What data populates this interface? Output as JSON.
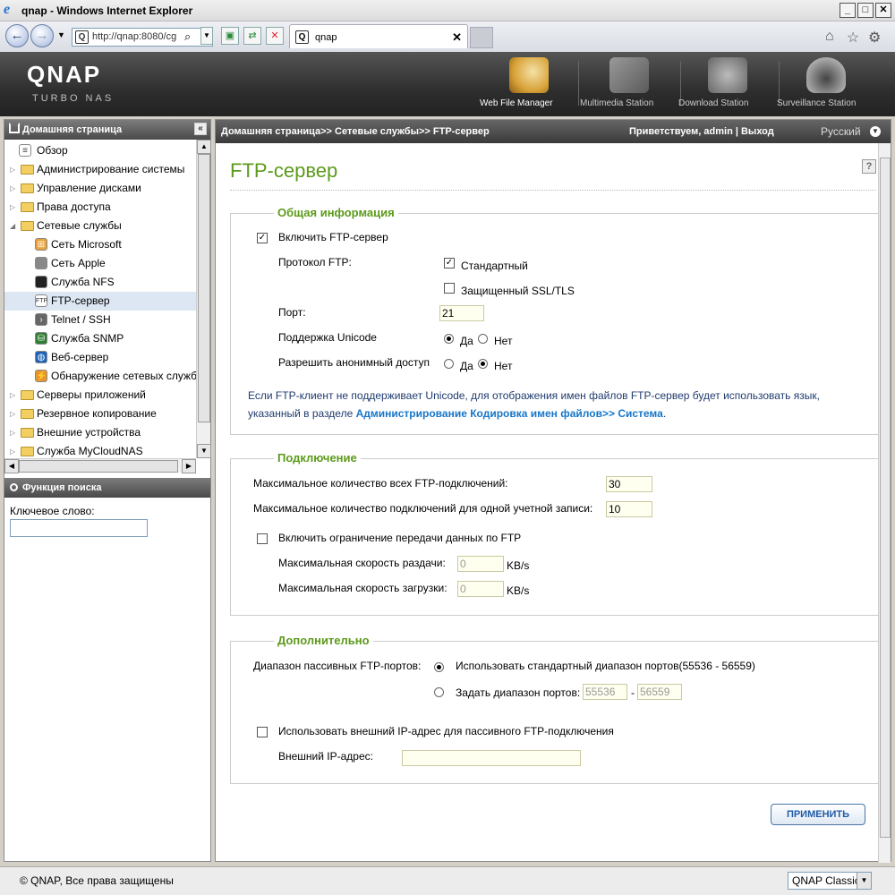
{
  "window": {
    "title": "qnap - Windows Internet Explorer",
    "address": "http://qnap:8080/cg",
    "tab_label": "qnap",
    "favicon_letter": "Q"
  },
  "header": {
    "logo": "QNAP",
    "subtitle": "TURBO NAS",
    "apps": [
      {
        "label": "Web File Manager",
        "color": "#d8a238"
      },
      {
        "label": "Multimedia Station",
        "color": "#7b7b7b"
      },
      {
        "label": "Download Station",
        "color": "#8a8a8a"
      },
      {
        "label": "Surveillance Station",
        "color": "#9a9a9a"
      }
    ]
  },
  "sidebar": {
    "title": "Домашняя страница",
    "items": [
      {
        "label": "Обзор"
      },
      {
        "label": "Администрирование системы"
      },
      {
        "label": "Управление дисками"
      },
      {
        "label": "Права доступа"
      },
      {
        "label": "Сетевые службы"
      },
      {
        "label": "Сеть Microsoft"
      },
      {
        "label": "Сеть Apple"
      },
      {
        "label": "Служба NFS"
      },
      {
        "label": "FTP-сервер"
      },
      {
        "label": "Telnet / SSH"
      },
      {
        "label": "Служба SNMP"
      },
      {
        "label": "Веб-сервер"
      },
      {
        "label": "Обнаружение сетевых служб"
      },
      {
        "label": "Серверы приложений"
      },
      {
        "label": "Резервное копирование"
      },
      {
        "label": "Внешние устройства"
      },
      {
        "label": "Служба MyCloudNAS"
      }
    ],
    "search_title": "Функция поиска",
    "keyword_label": "Ключевое слово:",
    "keyword_value": ""
  },
  "main": {
    "breadcrumb": "Домашняя страница>> Сетевые службы>> FTP-сервер",
    "welcome": "Приветствуем,  admin | Выход",
    "language": "Русский",
    "page_title": "FTP-сервер",
    "general": {
      "legend": "Общая информация",
      "enable_label": "Включить FTP-сервер",
      "enable_checked": true,
      "protocol_label": "Протокол FTP:",
      "standard_label": "Стандартный",
      "standard_checked": true,
      "ssl_label": "Защищенный SSL/TLS",
      "ssl_checked": false,
      "port_label": "Порт:",
      "port_value": "21",
      "unicode_label": "Поддержка Unicode",
      "anon_label": "Разрешить анонимный доступ",
      "yes": "Да",
      "no": "Нет",
      "note_text": "Если FTP-клиент не поддерживает Unicode, для отображения имен файлов FTP-сервер будет использовать язык, указанный в разделе ",
      "note_link": "Администрирование Кодировка имен файлов>> Система",
      "note_end": "."
    },
    "connection": {
      "legend": "Подключение",
      "max_all_label": "Максимальное количество всех FTP-подключений:",
      "max_all_value": "30",
      "max_account_label": "Максимальное количество подключений для одной учетной записи:",
      "max_account_value": "10",
      "limit_label": "Включить ограничение передачи данных по FTP",
      "upload_label": "Максимальная скорость раздачи:",
      "upload_value": "0",
      "download_label": "Максимальная скорость загрузки:",
      "download_value": "0",
      "unit": "KB/s"
    },
    "advanced": {
      "legend": "Дополнительно",
      "passive_label": "Диапазон пассивных FTP-портов:",
      "default_range_label": "Использовать стандартный диапазон портов(55536 - 56559)",
      "custom_range_label": "Задать диапазон портов:",
      "range_from": "55536",
      "range_sep": "-",
      "range_to": "56559",
      "external_ip_check_label": "Использовать внешний IP-адрес для пассивного FTP-подключения",
      "external_ip_label": "Внешний IP-адрес:",
      "external_ip_value": ""
    },
    "apply_label": "ПРИМЕНИТЬ"
  },
  "footer": {
    "copyright": "© QNAP, Все права защищены",
    "theme": "QNAP Classic"
  }
}
